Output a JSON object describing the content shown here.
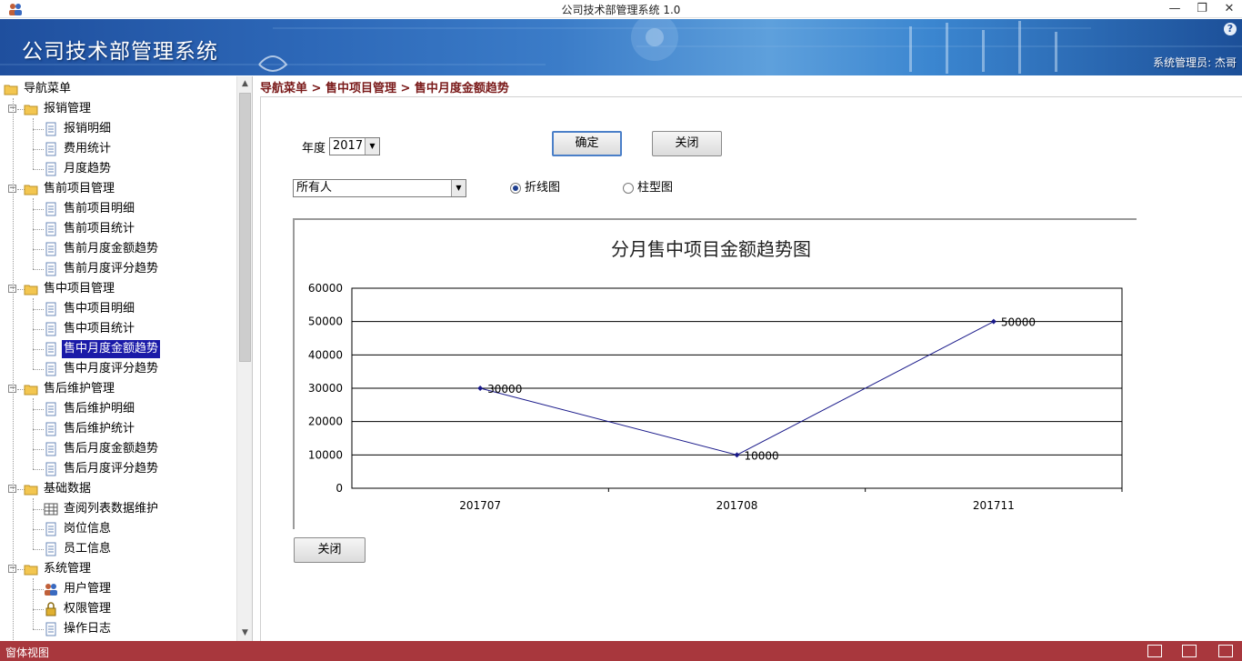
{
  "window": {
    "title": "公司技术部管理系统 1.0",
    "app_icon": "users-icon",
    "minimize": "—",
    "restore": "❐",
    "close": "✕"
  },
  "banner": {
    "brand": "公司技术部管理系统",
    "user": "系统管理员: 杰哥",
    "help": "?"
  },
  "sidebar": {
    "root": "导航菜单",
    "groups": [
      {
        "label": "报销管理",
        "items": [
          "报销明细",
          "费用统计",
          "月度趋势"
        ]
      },
      {
        "label": "售前项目管理",
        "items": [
          "售前项目明细",
          "售前项目统计",
          "售前月度金额趋势",
          "售前月度评分趋势"
        ]
      },
      {
        "label": "售中项目管理",
        "items": [
          "售中项目明细",
          "售中项目统计",
          "售中月度金额趋势",
          "售中月度评分趋势"
        ]
      },
      {
        "label": "售后维护管理",
        "items": [
          "售后维护明细",
          "售后维护统计",
          "售后月度金额趋势",
          "售后月度评分趋势"
        ]
      },
      {
        "label": "基础数据",
        "items": [
          "查阅列表数据维护",
          "岗位信息",
          "员工信息"
        ]
      },
      {
        "label": "系统管理",
        "items": [
          "用户管理",
          "权限管理",
          "操作日志"
        ]
      }
    ],
    "selected": "售中月度金额趋势"
  },
  "breadcrumb": "导航菜单 > 售中项目管理 > 售中月度金额趋势",
  "form": {
    "year_label": "年度",
    "year_value": "2017",
    "confirm_label": "确定",
    "close_label": "关闭",
    "person_value": "所有人",
    "radio_line_label": "折线图",
    "radio_bar_label": "柱型图",
    "bottom_close_label": "关闭"
  },
  "chart_data": {
    "type": "line",
    "title": "分月售中项目金额趋势图",
    "categories": [
      "201707",
      "201708",
      "201711"
    ],
    "values": [
      30000,
      10000,
      50000
    ],
    "data_labels": [
      "30000",
      "10000",
      "50000"
    ],
    "ylim": [
      0,
      60000
    ],
    "yticks": [
      "0",
      "10000",
      "20000",
      "30000",
      "40000",
      "50000",
      "60000"
    ],
    "grid": true,
    "line_color": "#1a1a8a"
  },
  "statusbar": {
    "text": "窗体视图"
  }
}
